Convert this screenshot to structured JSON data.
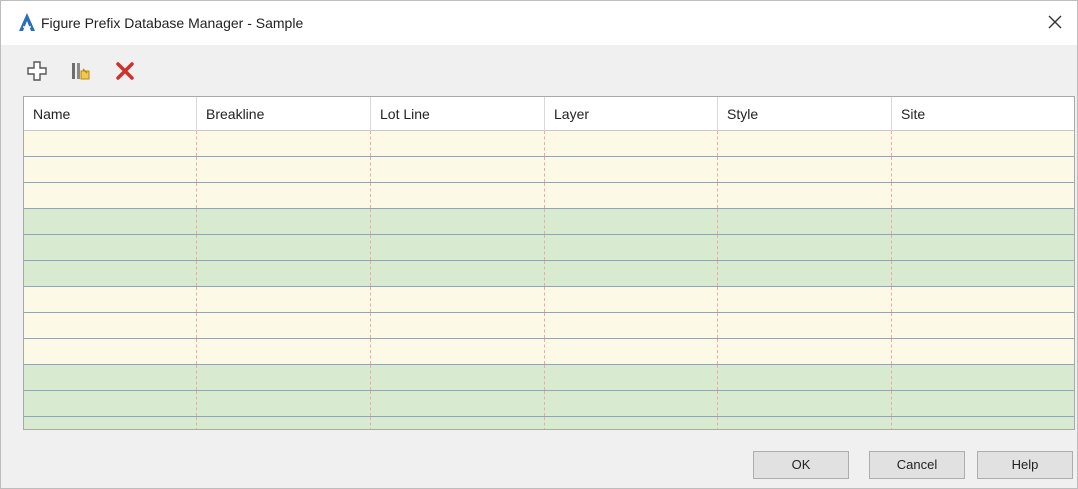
{
  "window": {
    "title": "Figure Prefix Database Manager - Sample",
    "app_icon": "autocad-civil-a-icon",
    "close_icon": "close-icon"
  },
  "toolbar": {
    "add_icon": "add-plus-icon",
    "import_icon": "import-figure-icon",
    "delete_icon": "delete-x-icon"
  },
  "table": {
    "columns": [
      "Name",
      "Breakline",
      "Lot Line",
      "Layer",
      "Style",
      "Site"
    ],
    "row_bands": [
      "light",
      "light",
      "light",
      "green",
      "green",
      "green",
      "light",
      "light",
      "light",
      "green",
      "green",
      "green"
    ]
  },
  "buttons": {
    "ok": "OK",
    "cancel": "Cancel",
    "help": "Help"
  },
  "colors": {
    "row_light": "#fdf9e7",
    "row_green": "#d8ebd1",
    "delete_red": "#d0312d",
    "accent_blue": "#2a6ebb"
  }
}
